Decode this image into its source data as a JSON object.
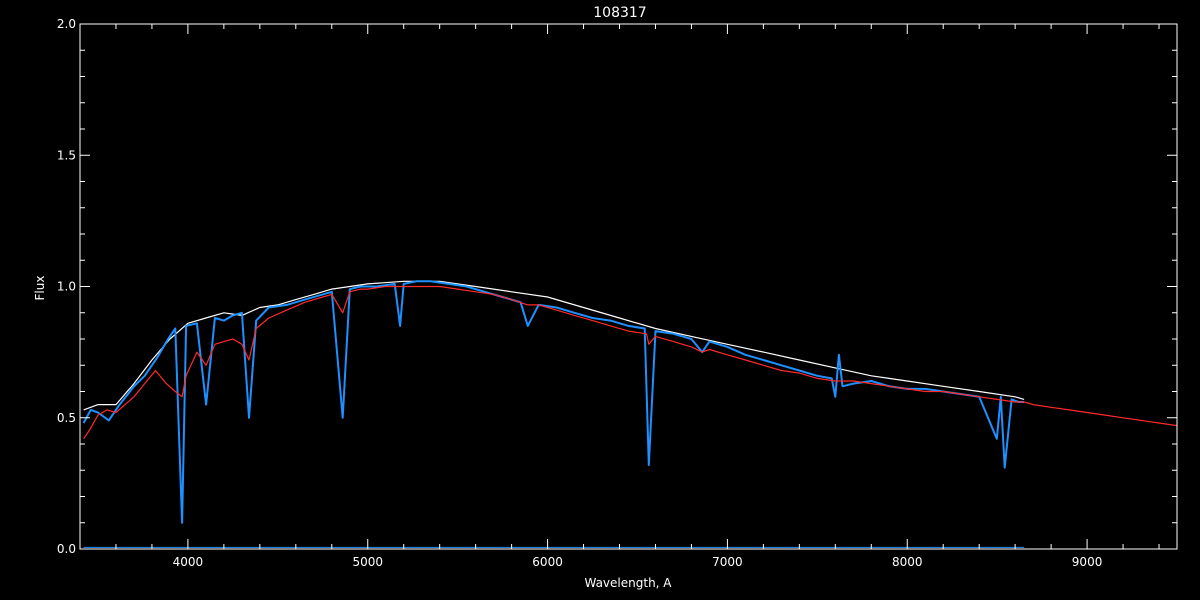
{
  "chart_data": {
    "type": "line",
    "title": "108317",
    "xlabel": "Wavelength, A",
    "ylabel": "Flux",
    "xlim": [
      3400,
      9500
    ],
    "ylim": [
      0.0,
      2.0
    ],
    "x_ticks": [
      4000,
      5000,
      6000,
      7000,
      8000,
      9000
    ],
    "y_ticks": [
      0.0,
      0.5,
      1.0,
      1.5,
      2.0
    ],
    "x_tick_labels": [
      "4000",
      "5000",
      "6000",
      "7000",
      "8000",
      "9000"
    ],
    "y_tick_labels": [
      "0.0",
      "0.5",
      "1.0",
      "1.5",
      "2.0"
    ],
    "grid": false,
    "background": "#000000",
    "series": [
      {
        "color": "#ffffff",
        "x": [
          3420,
          3500,
          3600,
          3700,
          3800,
          3900,
          4000,
          4100,
          4200,
          4300,
          4400,
          4500,
          4600,
          4700,
          4800,
          4900,
          5000,
          5200,
          5400,
          5600,
          5800,
          6000,
          6200,
          6400,
          6600,
          6800,
          7000,
          7200,
          7400,
          7600,
          7800,
          8000,
          8200,
          8400,
          8600,
          8650
        ],
        "y": [
          0.53,
          0.55,
          0.55,
          0.63,
          0.72,
          0.8,
          0.86,
          0.88,
          0.9,
          0.89,
          0.92,
          0.93,
          0.95,
          0.97,
          0.99,
          1.0,
          1.01,
          1.02,
          1.02,
          1.0,
          0.98,
          0.96,
          0.92,
          0.88,
          0.84,
          0.81,
          0.78,
          0.75,
          0.72,
          0.69,
          0.66,
          0.64,
          0.62,
          0.6,
          0.58,
          0.57
        ]
      },
      {
        "color": "#1e90ff",
        "x": [
          3420,
          3460,
          3500,
          3560,
          3620,
          3700,
          3760,
          3830,
          3890,
          3930,
          3968,
          3990,
          4050,
          4101,
          4150,
          4200,
          4250,
          4300,
          4340,
          4380,
          4450,
          4550,
          4650,
          4750,
          4800,
          4861,
          4900,
          4960,
          5050,
          5150,
          5180,
          5200,
          5270,
          5350,
          5450,
          5550,
          5650,
          5750,
          5850,
          5890,
          5950,
          6050,
          6150,
          6250,
          6350,
          6450,
          6540,
          6563,
          6600,
          6700,
          6800,
          6860,
          6900,
          7000,
          7100,
          7200,
          7300,
          7400,
          7500,
          7580,
          7600,
          7620,
          7640,
          7700,
          7800,
          7900,
          8000,
          8100,
          8200,
          8300,
          8400,
          8498,
          8520,
          8542,
          8580,
          8620,
          8650
        ],
        "y": [
          0.48,
          0.53,
          0.52,
          0.49,
          0.55,
          0.62,
          0.66,
          0.73,
          0.8,
          0.84,
          0.1,
          0.85,
          0.86,
          0.55,
          0.88,
          0.87,
          0.89,
          0.9,
          0.5,
          0.87,
          0.92,
          0.93,
          0.95,
          0.97,
          0.98,
          0.5,
          0.99,
          1.0,
          1.0,
          1.01,
          0.85,
          1.01,
          1.02,
          1.02,
          1.01,
          1.0,
          0.98,
          0.96,
          0.94,
          0.85,
          0.93,
          0.92,
          0.9,
          0.88,
          0.87,
          0.85,
          0.84,
          0.32,
          0.83,
          0.82,
          0.8,
          0.75,
          0.79,
          0.77,
          0.74,
          0.72,
          0.7,
          0.68,
          0.66,
          0.65,
          0.58,
          0.74,
          0.62,
          0.63,
          0.64,
          0.62,
          0.61,
          0.61,
          0.6,
          0.59,
          0.58,
          0.42,
          0.58,
          0.31,
          0.57,
          0.56,
          0.56
        ]
      },
      {
        "color": "#ff2a2a",
        "x": [
          3420,
          3450,
          3500,
          3550,
          3600,
          3650,
          3700,
          3760,
          3820,
          3880,
          3930,
          3968,
          3990,
          4050,
          4101,
          4150,
          4200,
          4250,
          4300,
          4340,
          4380,
          4450,
          4550,
          4650,
          4750,
          4800,
          4861,
          4900,
          4960,
          5000,
          5100,
          5200,
          5300,
          5400,
          5500,
          5600,
          5700,
          5800,
          5890,
          5950,
          6050,
          6150,
          6250,
          6350,
          6450,
          6550,
          6563,
          6600,
          6700,
          6800,
          6860,
          6900,
          7000,
          7100,
          7200,
          7300,
          7400,
          7500,
          7600,
          7700,
          7800,
          7900,
          8000,
          8100,
          8200,
          8300,
          8400,
          8500,
          8600,
          8650,
          8700,
          8800,
          8900,
          9000,
          9100,
          9200,
          9300,
          9400,
          9500
        ],
        "y": [
          0.42,
          0.45,
          0.51,
          0.53,
          0.52,
          0.55,
          0.58,
          0.63,
          0.68,
          0.63,
          0.6,
          0.58,
          0.66,
          0.75,
          0.7,
          0.78,
          0.79,
          0.8,
          0.78,
          0.72,
          0.84,
          0.88,
          0.91,
          0.94,
          0.96,
          0.97,
          0.9,
          0.98,
          0.99,
          0.99,
          1.0,
          1.0,
          1.0,
          1.0,
          0.99,
          0.98,
          0.97,
          0.95,
          0.93,
          0.93,
          0.91,
          0.89,
          0.87,
          0.85,
          0.83,
          0.82,
          0.78,
          0.81,
          0.79,
          0.77,
          0.75,
          0.76,
          0.74,
          0.72,
          0.7,
          0.68,
          0.67,
          0.65,
          0.64,
          0.64,
          0.63,
          0.62,
          0.61,
          0.6,
          0.6,
          0.59,
          0.58,
          0.57,
          0.56,
          0.56,
          0.55,
          0.54,
          0.53,
          0.52,
          0.51,
          0.5,
          0.49,
          0.48,
          0.47
        ]
      }
    ]
  }
}
